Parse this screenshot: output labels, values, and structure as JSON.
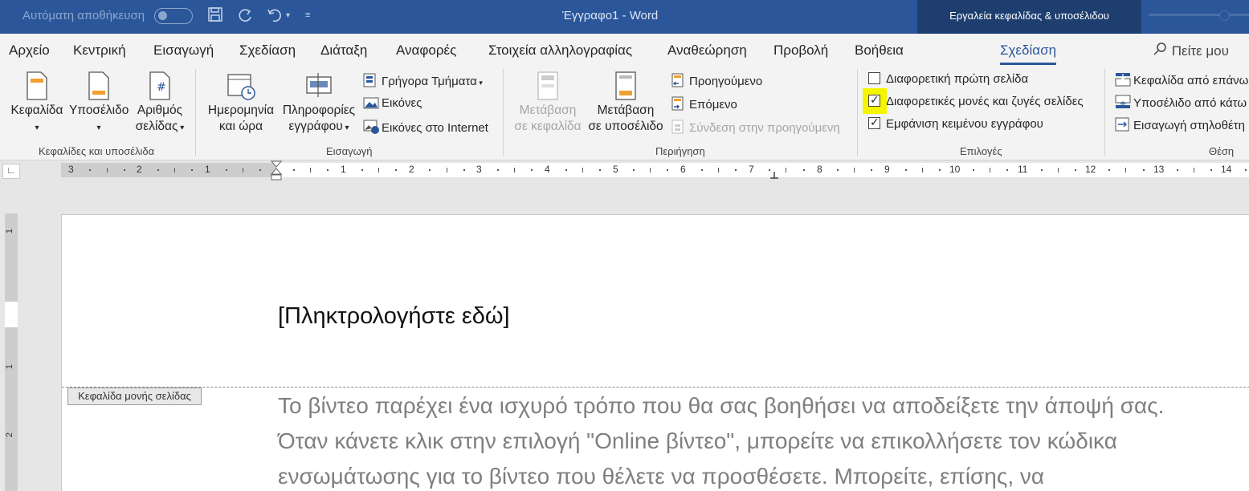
{
  "titlebar": {
    "autosave_label": "Αυτόματη αποθήκευση",
    "document_title": "Έγγραφο1  -  Word",
    "context_group": "Εργαλεία κεφαλίδας & υποσέλιδου"
  },
  "tabs": [
    {
      "label": "Αρχείο"
    },
    {
      "label": "Κεντρική"
    },
    {
      "label": "Εισαγωγή"
    },
    {
      "label": "Σχεδίαση"
    },
    {
      "label": "Διάταξη"
    },
    {
      "label": "Αναφορές"
    },
    {
      "label": "Στοιχεία αλληλογραφίας"
    },
    {
      "label": "Αναθεώρηση"
    },
    {
      "label": "Προβολή"
    },
    {
      "label": "Βοήθεια"
    },
    {
      "label": "Σχεδίαση",
      "active": true
    }
  ],
  "tell_me": "Πείτε μου",
  "ribbon": {
    "hf_group": {
      "label": "Κεφαλίδες και υποσέλιδα",
      "header": "Κεφαλίδα",
      "footer": "Υποσέλιδο",
      "page_number_1": "Αριθμός",
      "page_number_2": "σελίδας"
    },
    "insert_group": {
      "label": "Εισαγωγή",
      "datetime_1": "Ημερομηνία",
      "datetime_2": "και ώρα",
      "docinfo_1": "Πληροφορίες",
      "docinfo_2": "εγγράφου",
      "quick_parts": "Γρήγορα Τμήματα",
      "pictures": "Εικόνες",
      "online_pictures": "Εικόνες στο Internet"
    },
    "nav_group": {
      "label": "Περιήγηση",
      "goto_header_1": "Μετάβαση",
      "goto_header_2": "σε κεφαλίδα",
      "goto_footer_1": "Μετάβαση",
      "goto_footer_2": "σε υποσέλιδο",
      "previous": "Προηγούμενο",
      "next": "Επόμενο",
      "link_previous": "Σύνδεση στην προηγούμενη"
    },
    "options_group": {
      "label": "Επιλογές",
      "diff_first": "Διαφορετική πρώτη σελίδα",
      "diff_odd_even": "Διαφορετικές μονές και ζυγές σελίδες",
      "show_doc_text": "Εμφάνιση κειμένου εγγράφου",
      "diff_first_checked": false,
      "diff_odd_even_checked": true,
      "show_doc_text_checked": true
    },
    "position_group": {
      "label": "Θέση",
      "header_from_top": "Κεφαλίδα από επάνω",
      "footer_from_bottom": "Υποσέλιδο από κάτω",
      "insert_alignment_tab": "Εισαγωγή στηλοθέτη"
    }
  },
  "ruler": {
    "tab_selector": "∟",
    "left_numbers": [
      "3",
      "2",
      "1"
    ],
    "right_numbers": [
      "1",
      "2",
      "3",
      "4",
      "5",
      "6",
      "7",
      "8",
      "9",
      "10",
      "11",
      "12",
      "13",
      "14"
    ],
    "vertical_numbers": [
      "1",
      "1",
      "2"
    ]
  },
  "document": {
    "header_placeholder": "[Πληκτρολογήστε εδώ]",
    "header_tag": "Κεφαλίδα μονής σελίδας",
    "body_lines": [
      "Το βίντεο παρέχει ένα ισχυρό τρόπο που θα σας βοηθήσει να αποδείξετε την άποψή σας.",
      "Όταν κάνετε κλικ στην επιλογή \"Online βίντεο\", μπορείτε να επικολλήσετε τον κώδικα",
      "ενσωμάτωσης για το βίντεο που θέλετε να προσθέσετε. Μπορείτε, επίσης, να"
    ]
  }
}
